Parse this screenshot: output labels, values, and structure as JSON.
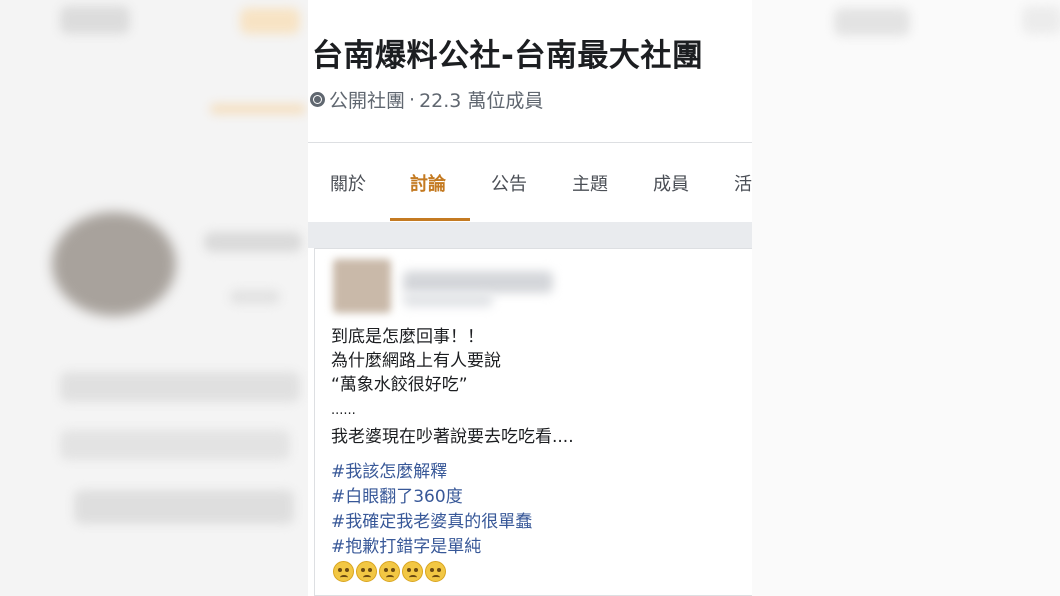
{
  "group": {
    "title": "台南爆料公社-台南最大社團",
    "visibility": "公開社團",
    "separator": "·",
    "members": "22.3 萬位成員"
  },
  "tabs": [
    {
      "label": "關於",
      "active": false
    },
    {
      "label": "討論",
      "active": true
    },
    {
      "label": "公告",
      "active": false
    },
    {
      "label": "主題",
      "active": false
    },
    {
      "label": "成員",
      "active": false
    },
    {
      "label": "活",
      "active": false
    }
  ],
  "post": {
    "lines": [
      "到底是怎麼回事！！",
      "為什麼網路上有人要說",
      "“萬象水餃很好吃”",
      "......",
      "我老婆現在吵著說要去吃吃看...."
    ],
    "hashtags": [
      "#我該怎麼解釋",
      "#白眼翻了360度",
      "#我確定我老婆真的很單蠢",
      "#抱歉打錯字是單純"
    ],
    "emoji_count": 5,
    "emoji_name": "rolling-eyes-emoji"
  },
  "colors": {
    "accent": "#c47a21",
    "hashtag": "#385898",
    "text": "#1c1e21",
    "muted": "#606770"
  }
}
